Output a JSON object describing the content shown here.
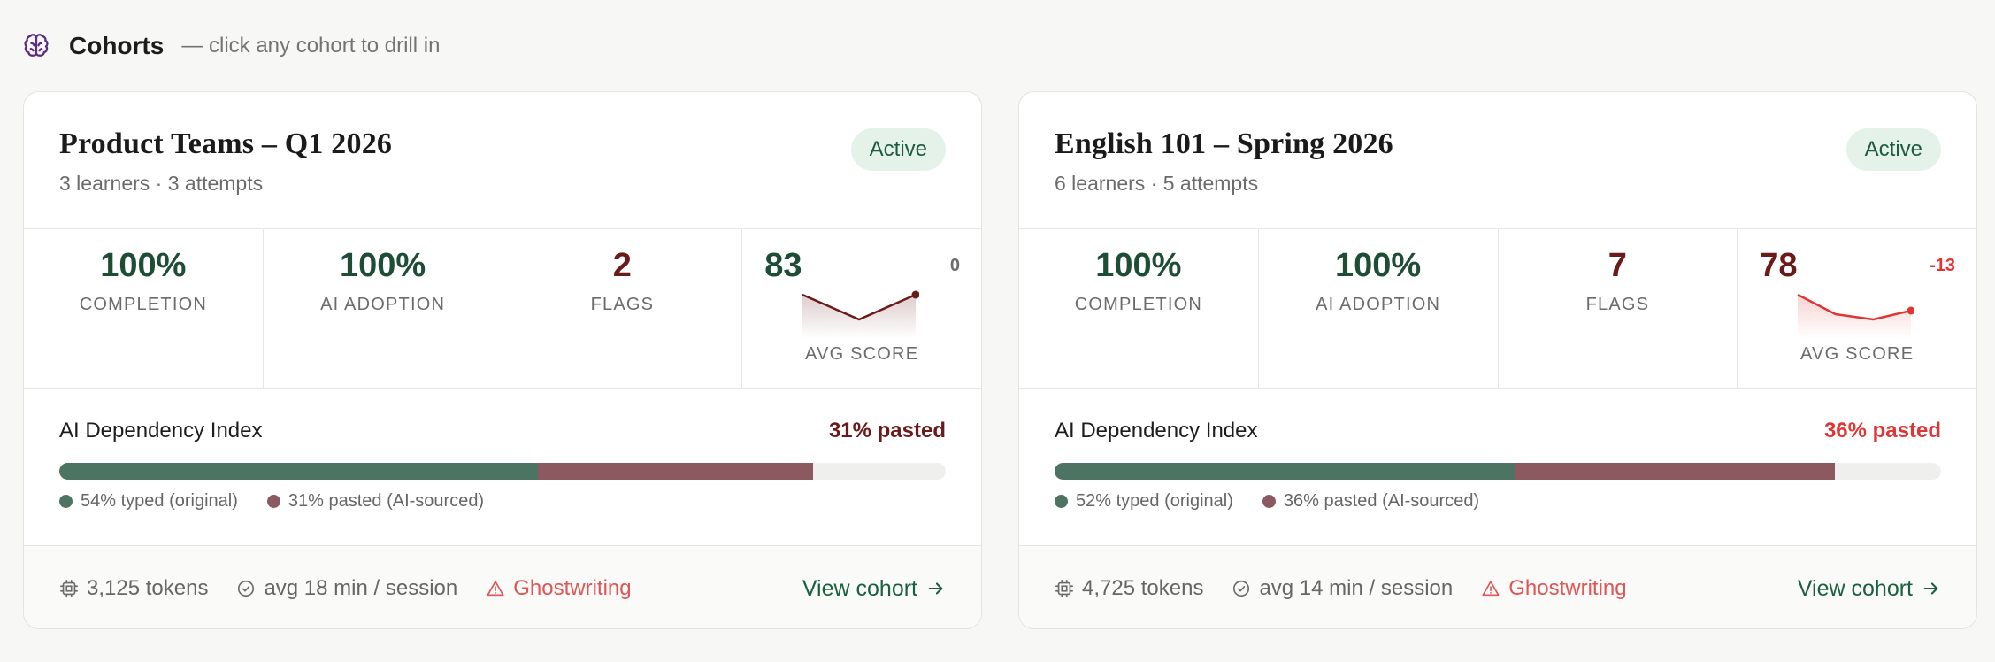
{
  "header": {
    "icon": "brain-icon",
    "title": "Cohorts",
    "hint": "— click any cohort to drill in"
  },
  "colors": {
    "accent_green": "#1e4d36",
    "maroon": "#6b1a1a",
    "alert_red": "#e03535",
    "typed_bar": "#4d7363",
    "pasted_bar": "#8d5960",
    "badge_bg": "#e5f2ea"
  },
  "cohorts": [
    {
      "title": "Product Teams – Q1 2026",
      "subtitle": "3 learners · 3 attempts",
      "status": "Active",
      "metrics": {
        "completion": {
          "value": "100%",
          "label": "COMPLETION"
        },
        "ai_adoption": {
          "value": "100%",
          "label": "AI ADOPTION"
        },
        "flags": {
          "value": "2",
          "label": "FLAGS"
        },
        "avg_score": {
          "value": "83",
          "delta": "0",
          "label": "AVG SCORE",
          "trend": [
            83,
            79,
            83
          ]
        }
      },
      "dependency": {
        "title": "AI Dependency Index",
        "pasted_summary": "31% pasted",
        "typed_pct": 54,
        "pasted_pct": 31,
        "typed_label": "54% typed (original)",
        "pasted_label": "31% pasted (AI-sourced)"
      },
      "footer": {
        "tokens": "3,125 tokens",
        "session": "avg 18 min / session",
        "flag": "Ghostwriting",
        "view": "View cohort"
      }
    },
    {
      "title": "English 101 – Spring 2026",
      "subtitle": "6 learners · 5 attempts",
      "status": "Active",
      "metrics": {
        "completion": {
          "value": "100%",
          "label": "COMPLETION"
        },
        "ai_adoption": {
          "value": "100%",
          "label": "AI ADOPTION"
        },
        "flags": {
          "value": "7",
          "label": "FLAGS"
        },
        "avg_score": {
          "value": "78",
          "delta": "-13",
          "label": "AVG SCORE",
          "trend": [
            91,
            80,
            77,
            82
          ]
        }
      },
      "dependency": {
        "title": "AI Dependency Index",
        "pasted_summary": "36% pasted",
        "typed_pct": 52,
        "pasted_pct": 36,
        "typed_label": "52% typed (original)",
        "pasted_label": "36% pasted (AI-sourced)"
      },
      "footer": {
        "tokens": "4,725 tokens",
        "session": "avg 14 min / session",
        "flag": "Ghostwriting",
        "view": "View cohort"
      }
    }
  ]
}
